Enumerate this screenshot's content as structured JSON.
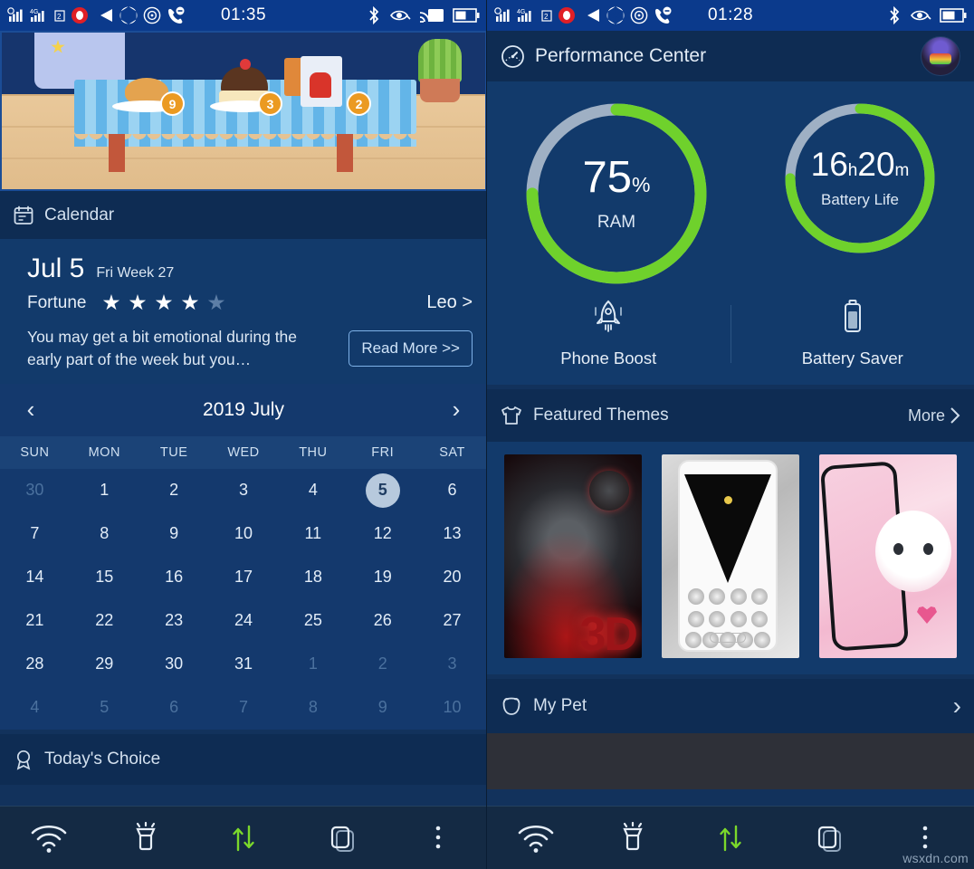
{
  "left_phone": {
    "statusbar": {
      "clock": "01:35",
      "left_icons": [
        "signal-bars-icon",
        "signal-4g-icon",
        "sim2-icon",
        "record-icon",
        "volume-mute-icon",
        "aperture-icon",
        "target-icon",
        "call-reject-icon"
      ],
      "right_icons": [
        "bluetooth-icon",
        "eye-icon",
        "cast-icon",
        "battery-icon"
      ]
    },
    "game_banner": {
      "name": "bakery-game-banner",
      "badges": [
        "9",
        "3",
        "2"
      ]
    },
    "calendar_card": {
      "icon": "calendar-icon",
      "title": "Calendar",
      "fortune": {
        "day": "Jul 5",
        "sub": "Fri Week 27",
        "label": "Fortune",
        "stars_filled": 4,
        "stars_total": 5,
        "sign": "Leo >",
        "text": "You may get a bit emotional during the early part of the week but you…",
        "read_more": "Read More >>"
      },
      "month": {
        "prev": "‹",
        "title": "2019 July",
        "next": "›",
        "dow": [
          "SUN",
          "MON",
          "TUE",
          "WED",
          "THU",
          "FRI",
          "SAT"
        ],
        "weeks": [
          [
            {
              "d": "30",
              "dim": true
            },
            {
              "d": "1"
            },
            {
              "d": "2"
            },
            {
              "d": "3"
            },
            {
              "d": "4"
            },
            {
              "d": "5",
              "sel": true
            },
            {
              "d": "6"
            }
          ],
          [
            {
              "d": "7"
            },
            {
              "d": "8"
            },
            {
              "d": "9"
            },
            {
              "d": "10"
            },
            {
              "d": "11"
            },
            {
              "d": "12"
            },
            {
              "d": "13"
            }
          ],
          [
            {
              "d": "14"
            },
            {
              "d": "15"
            },
            {
              "d": "16"
            },
            {
              "d": "17"
            },
            {
              "d": "18"
            },
            {
              "d": "19"
            },
            {
              "d": "20"
            }
          ],
          [
            {
              "d": "21"
            },
            {
              "d": "22"
            },
            {
              "d": "23"
            },
            {
              "d": "24"
            },
            {
              "d": "25"
            },
            {
              "d": "26"
            },
            {
              "d": "27"
            }
          ],
          [
            {
              "d": "28"
            },
            {
              "d": "29"
            },
            {
              "d": "30"
            },
            {
              "d": "31"
            },
            {
              "d": "1",
              "dim": true
            },
            {
              "d": "2",
              "dim": true
            },
            {
              "d": "3",
              "dim": true
            }
          ],
          [
            {
              "d": "4",
              "dim": true
            },
            {
              "d": "5",
              "dim": true
            },
            {
              "d": "6",
              "dim": true
            },
            {
              "d": "7",
              "dim": true
            },
            {
              "d": "8",
              "dim": true
            },
            {
              "d": "9",
              "dim": true
            },
            {
              "d": "10",
              "dim": true
            }
          ]
        ]
      }
    },
    "todays_choice": {
      "icon": "award-ribbon-icon",
      "title": "Today's Choice"
    },
    "navbar": [
      "wifi-icon",
      "flashlight-icon",
      "data-transfer-icon",
      "task-manager-icon",
      "more-menu-icon"
    ]
  },
  "right_phone": {
    "statusbar": {
      "clock": "01:28",
      "left_icons": [
        "signal-bars-icon",
        "signal-4g-icon",
        "sim2-icon",
        "record-icon",
        "volume-mute-icon",
        "aperture-icon",
        "target-icon",
        "call-reject-icon"
      ],
      "right_icons": [
        "bluetooth-icon",
        "eye-icon",
        "battery-icon"
      ]
    },
    "performance_center": {
      "icon": "speedometer-icon",
      "title": "Performance Center",
      "avatar": "user-avatar",
      "ram": {
        "value": "75",
        "unit": "%",
        "label": "RAM",
        "percent": 75,
        "color": "#6fd12c",
        "track": "#9fb0c4"
      },
      "battery": {
        "hours": "16",
        "h_unit": "h",
        "minutes": "20",
        "m_unit": "m",
        "label": "Battery Life",
        "percent": 75,
        "color": "#6fd12c",
        "track": "#9fb0c4"
      },
      "actions": [
        {
          "icon": "rocket-icon",
          "label": "Phone Boost"
        },
        {
          "icon": "battery-saver-icon",
          "label": "Battery Saver"
        }
      ]
    },
    "featured_themes": {
      "icon": "tshirt-icon",
      "title": "Featured Themes",
      "more": "More",
      "more_icon": "chevron-right-icon",
      "thumbs": [
        {
          "name": "theme-3d-warrior",
          "caption": "3D"
        },
        {
          "name": "theme-diamond-zipper",
          "caption": ""
        },
        {
          "name": "theme-pink-kitty",
          "caption": ""
        }
      ]
    },
    "my_pet": {
      "icon": "pet-bear-icon",
      "title": "My Pet",
      "chevron": "›"
    },
    "navbar": [
      "wifi-icon",
      "flashlight-icon",
      "data-transfer-icon",
      "task-manager-icon",
      "more-menu-icon"
    ]
  },
  "watermark": "wsxdn.com",
  "colors": {
    "accent_green": "#6fd12c",
    "panel": "#123a6b",
    "header": "#0e2c53",
    "statusbar": "#0b3a8c"
  }
}
